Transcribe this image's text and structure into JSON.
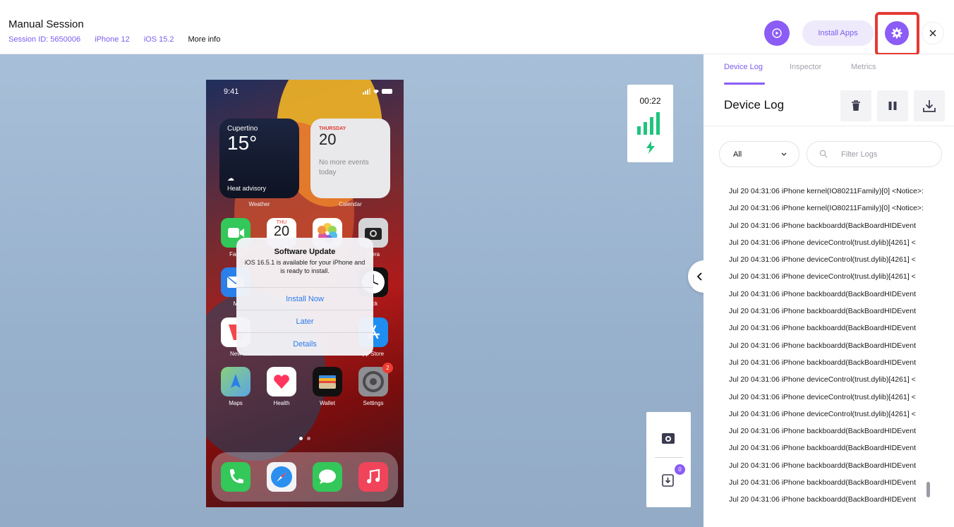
{
  "header": {
    "title": "Manual Session",
    "session_id": "Session ID: 5650006",
    "device": "iPhone 12",
    "os": "iOS 15.2",
    "more_info": "More info",
    "install_apps": "Install Apps"
  },
  "phone": {
    "time": "9:41",
    "weather": {
      "city": "Cupertino",
      "temp": "15°",
      "advisory": "Heat advisory",
      "label": "Weather"
    },
    "calendar": {
      "day": "THURSDAY",
      "date": "20",
      "events": "No more events today",
      "label": "Calendar"
    },
    "apps_row1": [
      "Face",
      "",
      "",
      "mera"
    ],
    "apps_row2": [
      "M",
      "",
      "",
      "ock"
    ],
    "apps_row3": [
      "New",
      "",
      "",
      "pp Store"
    ],
    "apps_row4": [
      "Maps",
      "Health",
      "Wallet",
      "Settings"
    ],
    "calendar_icon": {
      "day": "THU",
      "date": "20"
    },
    "settings_badge": "2",
    "alert": {
      "title": "Software Update",
      "message": "iOS 16.5.1 is available for your iPhone and is ready to install.",
      "buttons": [
        "Install Now",
        "Later",
        "Details"
      ]
    }
  },
  "stats": {
    "timer": "00:22"
  },
  "tools": {
    "count": "0"
  },
  "panel": {
    "tabs": [
      "Device Log",
      "Inspector",
      "Metrics"
    ],
    "active_tab": "Device Log",
    "title": "Device Log",
    "filter_select": "All",
    "filter_placeholder": "Filter Logs",
    "logs": [
      "Jul 20 04:31:06 iPhone kernel(IO80211Family)[0] <Notice>:",
      "Jul 20 04:31:06 iPhone kernel(IO80211Family)[0] <Notice>:",
      "Jul 20 04:31:06 iPhone backboardd(BackBoardHIDEvent",
      "Jul 20 04:31:06 iPhone deviceControl(trust.dylib)[4261] <",
      "Jul 20 04:31:06 iPhone deviceControl(trust.dylib)[4261] <",
      "Jul 20 04:31:06 iPhone deviceControl(trust.dylib)[4261] <",
      "Jul 20 04:31:06 iPhone backboardd(BackBoardHIDEvent",
      "Jul 20 04:31:06 iPhone backboardd(BackBoardHIDEvent",
      "Jul 20 04:31:06 iPhone backboardd(BackBoardHIDEvent",
      "Jul 20 04:31:06 iPhone backboardd(BackBoardHIDEvent",
      "Jul 20 04:31:06 iPhone backboardd(BackBoardHIDEvent",
      "Jul 20 04:31:06 iPhone deviceControl(trust.dylib)[4261] <",
      "Jul 20 04:31:06 iPhone deviceControl(trust.dylib)[4261] <",
      "Jul 20 04:31:06 iPhone deviceControl(trust.dylib)[4261] <",
      "Jul 20 04:31:06 iPhone backboardd(BackBoardHIDEvent",
      "Jul 20 04:31:06 iPhone backboardd(BackBoardHIDEvent",
      "Jul 20 04:31:06 iPhone backboardd(BackBoardHIDEvent",
      "Jul 20 04:31:06 iPhone backboardd(BackBoardHIDEvent",
      "Jul 20 04:31:06 iPhone backboardd(BackBoardHIDEvent"
    ]
  },
  "colors": {
    "accent": "#8b5cf6",
    "highlight": "#e53935",
    "signal": "#1fc47d"
  }
}
